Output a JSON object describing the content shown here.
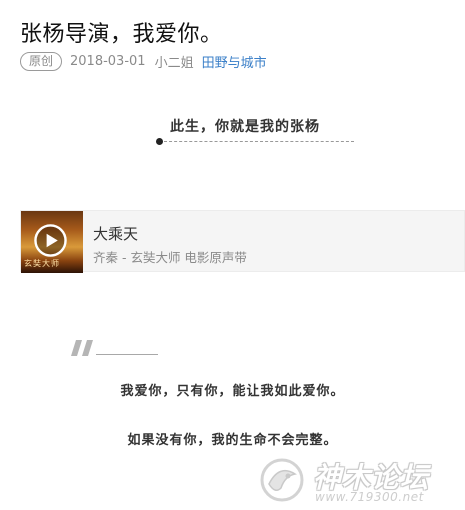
{
  "article": {
    "title": "张杨导演，我爱你。",
    "meta": {
      "original_badge": "原创",
      "date": "2018-03-01",
      "author": "小二姐",
      "account": "田野与城市"
    },
    "banner_text": "此生，你就是我的张杨"
  },
  "music": {
    "cover_caption": "玄奘大师",
    "title": "大乘天",
    "subtitle": "齐秦 - 玄奘大师 电影原声带",
    "play_icon": "play-icon"
  },
  "body": {
    "line1": "我爱你，只有你，能让我如此爱你。",
    "line2": "如果没有你，我的生命不会完整。"
  },
  "watermark": {
    "text": "神木论坛",
    "url": "www.719300.net"
  },
  "colors": {
    "accent_link": "#3a7fc8",
    "meta_gray": "#8a8a8a",
    "music_bg": "#f5f5f5"
  }
}
